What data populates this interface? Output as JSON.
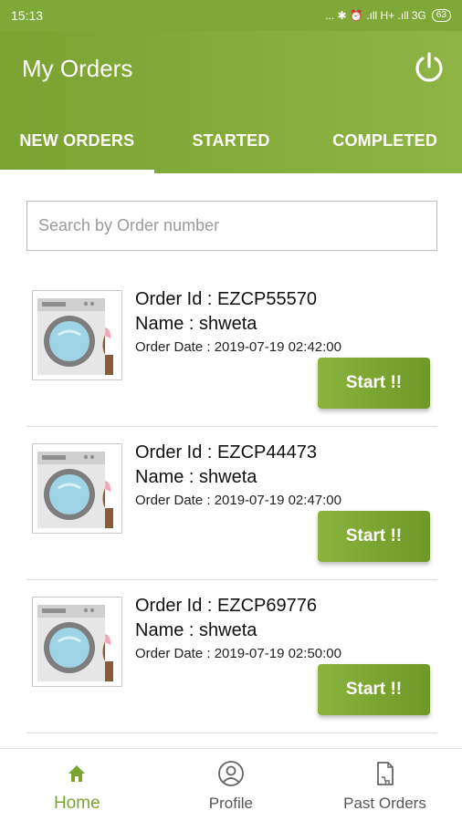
{
  "status_bar": {
    "time": "15:13",
    "signal_text": "... ✱ ⏰ .ıll H+ .ıll 3G",
    "battery": "63"
  },
  "app_bar": {
    "title": "My Orders",
    "accent_color": "#7aa332"
  },
  "tabs": [
    {
      "label": "NEW ORDERS",
      "active": true
    },
    {
      "label": "STARTED",
      "active": false
    },
    {
      "label": "COMPLETED",
      "active": false
    }
  ],
  "search": {
    "placeholder": "Search by Order number",
    "value": ""
  },
  "orders": [
    {
      "id_text": "Order Id : EZCP55570",
      "name_text": "Name : shweta",
      "date_text": "Order Date : 2019-07-19 02:42:00",
      "button": "Start !!"
    },
    {
      "id_text": "Order Id : EZCP44473",
      "name_text": "Name : shweta",
      "date_text": "Order Date : 2019-07-19 02:47:00",
      "button": "Start !!"
    },
    {
      "id_text": "Order Id : EZCP69776",
      "name_text": "Name : shweta",
      "date_text": "Order Date : 2019-07-19 02:50:00",
      "button": "Start !!"
    }
  ],
  "bottom_nav": [
    {
      "label": "Home",
      "icon": "home-icon",
      "active": true
    },
    {
      "label": "Profile",
      "icon": "profile-icon",
      "active": false
    },
    {
      "label": "Past Orders",
      "icon": "past-orders-icon",
      "active": false
    }
  ]
}
